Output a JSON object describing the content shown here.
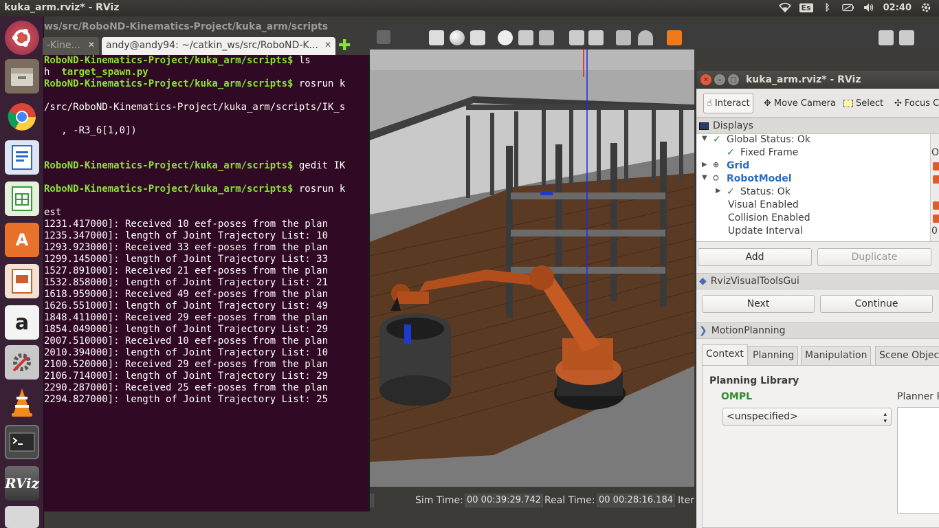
{
  "top_panel": {
    "title": "kuka_arm.rviz* - RViz",
    "keyboard_layout": "Es",
    "clock": "02:40"
  },
  "launcher": {
    "items": [
      "ubuntu-logo",
      "files-icon",
      "chrome-icon",
      "writer-icon",
      "calc-icon",
      "software-center-icon",
      "impress-icon",
      "amazon-icon",
      "settings-icon",
      "vlc-icon",
      "terminal-icon",
      "rviz-icon",
      "drive-icon"
    ],
    "rviz_label": "RViz"
  },
  "terminal": {
    "window_title": "ws/src/RoboND-Kinematics-Project/kuka_arm/scripts",
    "tabs": [
      {
        "label": "-Kine...",
        "active": false
      },
      {
        "label": "andy@andy94: ~/catkin_ws/src/RoboND-K...",
        "active": true
      }
    ],
    "lines": [
      {
        "prompt": "RoboND-Kinematics-Project/kuka_arm/scripts$",
        "cmd": " ls"
      },
      {
        "pre": "h  ",
        "green": "target_spawn.py"
      },
      {
        "prompt": "RoboND-Kinematics-Project/kuka_arm/scripts$",
        "cmd": " rosrun k"
      },
      {
        "text": ""
      },
      {
        "text": "/src/RoboND-Kinematics-Project/kuka_arm/scripts/IK_s"
      },
      {
        "text": ""
      },
      {
        "text": "   , -R3_6[1,0])"
      },
      {
        "text": ""
      },
      {
        "text": ""
      },
      {
        "prompt": "RoboND-Kinematics-Project/kuka_arm/scripts$",
        "cmd": " gedit IK"
      },
      {
        "text": ""
      },
      {
        "prompt": "RoboND-Kinematics-Project/kuka_arm/scripts$",
        "cmd": " rosrun k"
      },
      {
        "text": ""
      },
      {
        "text": "est"
      },
      {
        "text": "1231.417000]: Received 10 eef-poses from the plan"
      },
      {
        "text": "1235.347000]: length of Joint Trajectory List: 10"
      },
      {
        "text": "1293.923000]: Received 33 eef-poses from the plan"
      },
      {
        "text": "1299.145000]: length of Joint Trajectory List: 33"
      },
      {
        "text": "1527.891000]: Received 21 eef-poses from the plan"
      },
      {
        "text": "1532.858000]: length of Joint Trajectory List: 21"
      },
      {
        "text": "1618.959000]: Received 49 eef-poses from the plan"
      },
      {
        "text": "1626.551000]: length of Joint Trajectory List: 49"
      },
      {
        "text": "1848.411000]: Received 29 eef-poses from the plan"
      },
      {
        "text": "1854.049000]: length of Joint Trajectory List: 29"
      },
      {
        "text": "2007.510000]: Received 10 eef-poses from the plan"
      },
      {
        "text": "2010.394000]: length of Joint Trajectory List: 10"
      },
      {
        "text": "2100.520000]: Received 29 eef-poses from the plan"
      },
      {
        "text": "2106.714000]: length of Joint Trajectory List: 29"
      },
      {
        "text": "2290.287000]: Received 25 eef-poses from the plan"
      },
      {
        "text": "2294.827000]: length of Joint Trajectory List: 25"
      }
    ]
  },
  "statusbar": {
    "sim_time_label": "Sim Time:",
    "sim_time": "00 00:39:29.742",
    "real_time_label": "Real Time:",
    "real_time": "00 00:28:16.184",
    "iter_label": "Iter"
  },
  "rviz_panel": {
    "title": "kuka_arm.rviz* - RViz",
    "tools": [
      "Interact",
      "Move Camera",
      "Select",
      "Focus Ca"
    ],
    "displays_header": "Displays",
    "tree": [
      {
        "label": "Global Status: Ok",
        "indent": 0,
        "arrow": "down",
        "check": true,
        "style": "plain"
      },
      {
        "label": "Fixed Frame",
        "indent": 1,
        "arrow": "",
        "check": true,
        "style": "plain",
        "value": "O"
      },
      {
        "label": "Grid",
        "indent": 0,
        "arrow": "right",
        "check": false,
        "style": "blue",
        "icon": "grid-icon",
        "box": true
      },
      {
        "label": "RobotModel",
        "indent": 0,
        "arrow": "down",
        "check": false,
        "style": "blue",
        "icon": "robot-icon",
        "box": true
      },
      {
        "label": "Status: Ok",
        "indent": 1,
        "arrow": "right",
        "check": true,
        "style": "plain"
      },
      {
        "label": "Visual Enabled",
        "indent": 1,
        "arrow": "",
        "check": false,
        "style": "plain",
        "box": true
      },
      {
        "label": "Collision Enabled",
        "indent": 1,
        "arrow": "",
        "check": false,
        "style": "plain",
        "box": true
      },
      {
        "label": "Update Interval",
        "indent": 1,
        "arrow": "",
        "check": false,
        "style": "plain",
        "value": "0"
      }
    ],
    "add_button": "Add",
    "duplicate_button": "Duplicate",
    "rviz_tools_header": "RvizVisualToolsGui",
    "next_button": "Next",
    "continue_button": "Continue",
    "motion_planning_header": "MotionPlanning",
    "mp_tabs": [
      "Context",
      "Planning",
      "Manipulation",
      "Scene Object"
    ],
    "planning_library_label": "Planning Library",
    "ompl_label": "OMPL",
    "planner_select": "<unspecified>",
    "planner_params_label": "Planner P"
  }
}
